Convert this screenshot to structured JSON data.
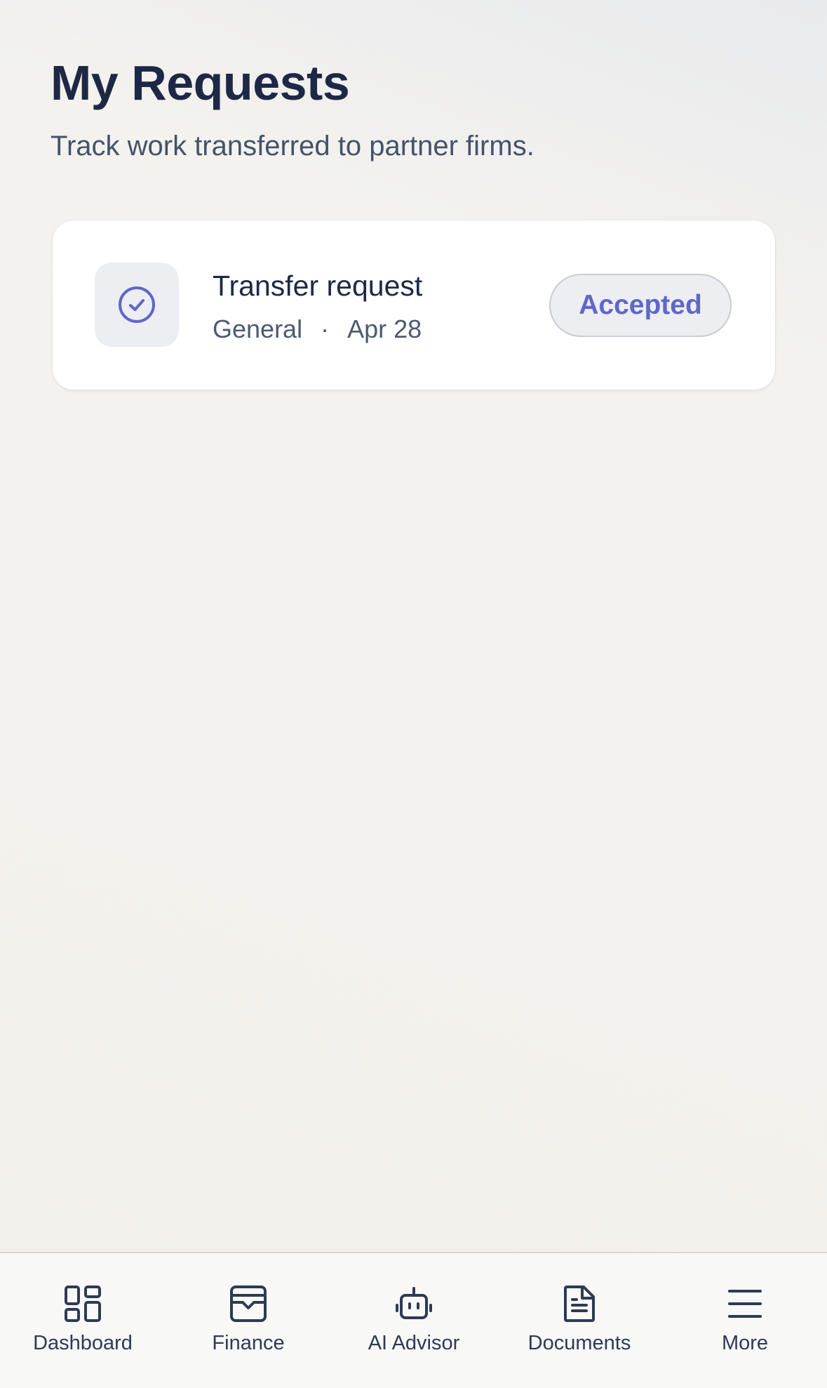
{
  "header": {
    "title": "My Requests",
    "subtitle": "Track work transferred to partner firms."
  },
  "requests": [
    {
      "icon": "check-circle-icon",
      "title": "Transfer request",
      "category": "General",
      "separator": "·",
      "date": "Apr 28",
      "status": "Accepted"
    }
  ],
  "nav": {
    "items": [
      {
        "label": "Dashboard",
        "icon": "dashboard-icon"
      },
      {
        "label": "Finance",
        "icon": "finance-icon"
      },
      {
        "label": "AI Advisor",
        "icon": "robot-icon"
      },
      {
        "label": "Documents",
        "icon": "document-icon"
      },
      {
        "label": "More",
        "icon": "menu-icon"
      }
    ]
  },
  "colors": {
    "title": "#1e2846",
    "accent": "#5f67c9",
    "badge_bg": "#eceef2",
    "nav_icon": "#2e3a55"
  }
}
